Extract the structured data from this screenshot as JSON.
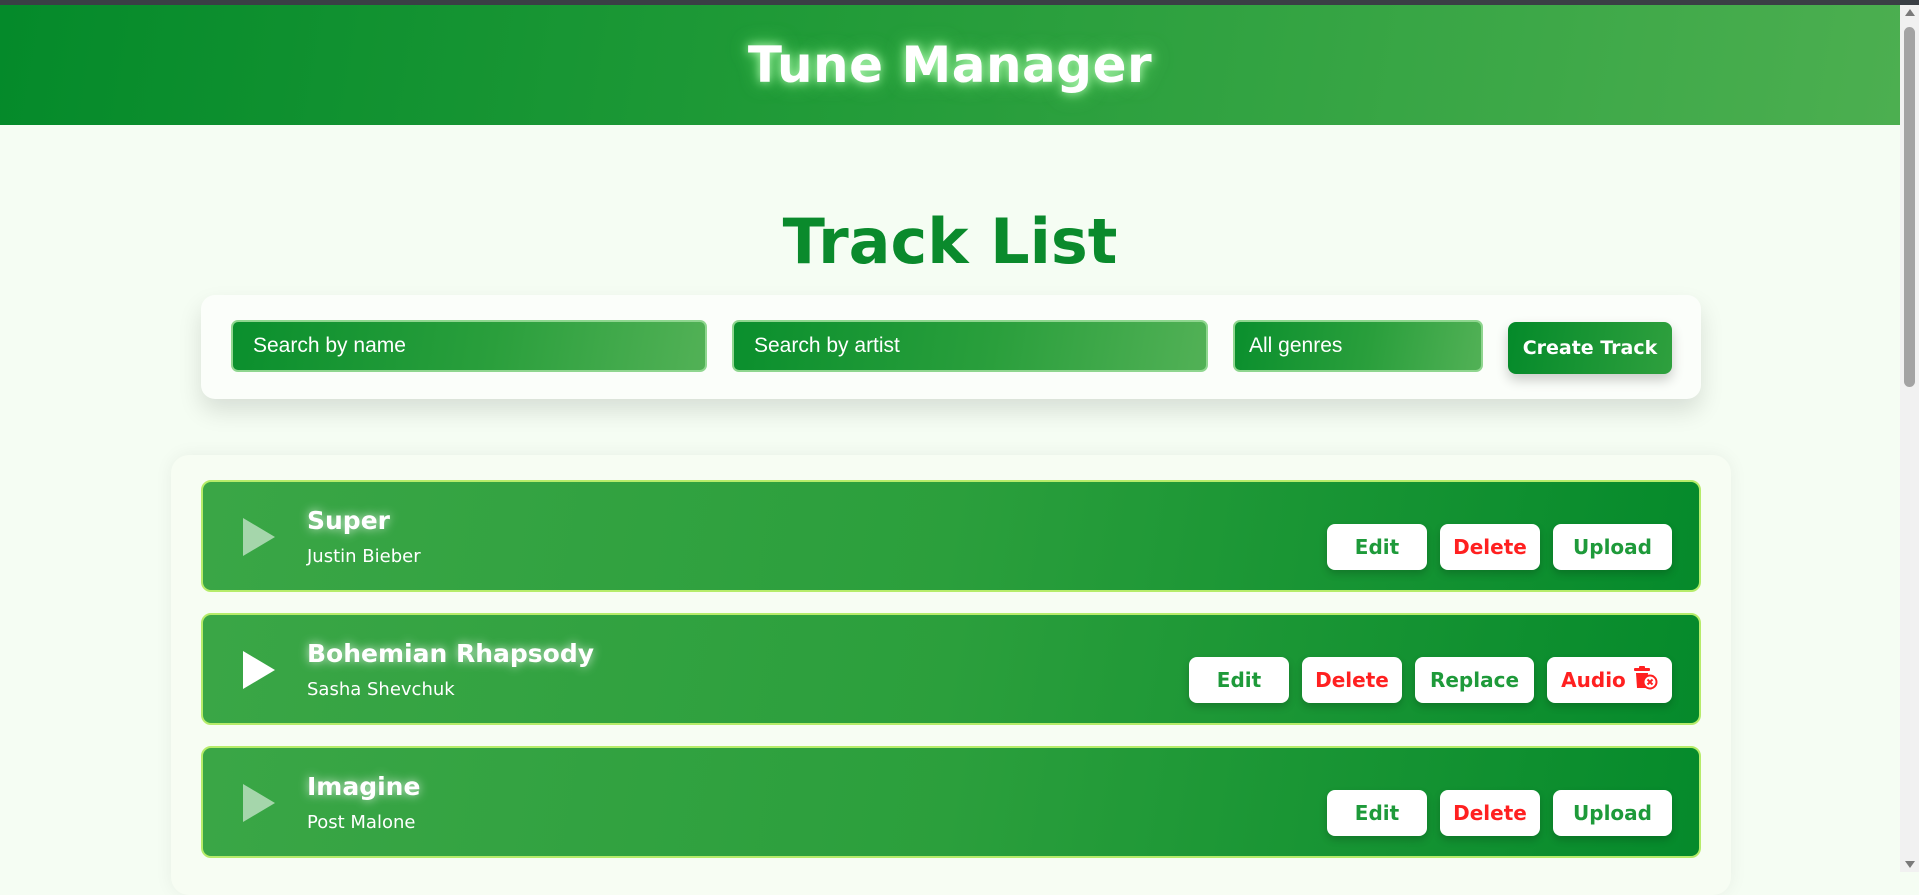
{
  "header": {
    "app_title": "Tune Manager"
  },
  "page": {
    "title": "Track List"
  },
  "toolbar": {
    "search_name_placeholder": "Search by name",
    "search_artist_placeholder": "Search by artist",
    "genre_selected": "All genres",
    "create_label": "Create Track"
  },
  "tracks": [
    {
      "title": "Super",
      "artist": "Justin Bieber",
      "playable": false,
      "actions": {
        "edit": "Edit",
        "delete": "Delete",
        "upload": "Upload"
      }
    },
    {
      "title": "Bohemian Rhapsody",
      "artist": "Sasha Shevchuk",
      "playable": true,
      "actions": {
        "edit": "Edit",
        "delete": "Delete",
        "replace": "Replace",
        "audio": "Audio"
      },
      "audio_icon": "remove-audio-icon"
    },
    {
      "title": "Imagine",
      "artist": "Post Malone",
      "playable": false,
      "actions": {
        "edit": "Edit",
        "delete": "Delete",
        "upload": "Upload"
      }
    }
  ],
  "colors": {
    "accent": "#0a8a2c",
    "danger": "#ff2020",
    "background": "#f5fdf3"
  }
}
